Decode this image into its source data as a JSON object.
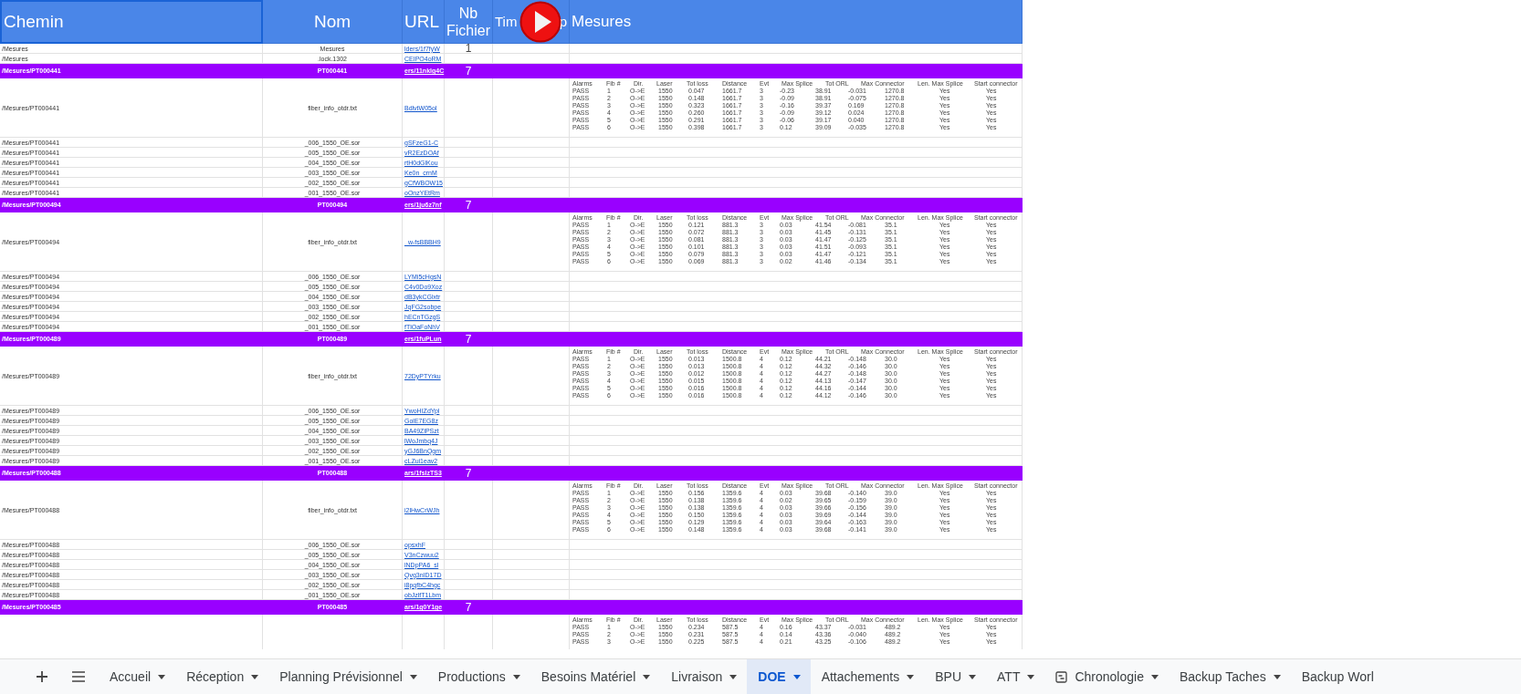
{
  "header": {
    "chemin": "Chemin",
    "nom": "Nom",
    "url": "URL",
    "nb_fichier": "Nb Fichier",
    "timestamp_visible_start": "Tim",
    "timestamp_visible_end": "p",
    "mesures": "Mesures"
  },
  "rows": [
    {
      "kind": "file",
      "chemin": "/Mesures",
      "nom": "Mesures",
      "url": "lders/1f7fyW",
      "count": "1"
    },
    {
      "kind": "file",
      "chemin": "/Mesures",
      "nom": ".lock.1302",
      "url": "CEIPO4oRM"
    },
    {
      "kind": "folder",
      "chemin": "/Mesures/PT000441",
      "nom": "PT000441",
      "url": "ers/11nklg4C",
      "count": "7"
    },
    {
      "kind": "info",
      "chemin": "/Mesures/PT000441",
      "nom": "fiber_info_otdr.txt",
      "url": "BdlvtW05oI",
      "measures": {
        "headers": [
          "Alarms",
          "Fib #",
          "Dir.",
          "Laser",
          "Tot loss",
          "Distance",
          "Evt",
          "Max Splice",
          "Tot ORL",
          "Max Connector",
          "Len. Max Splice",
          "Start connector"
        ],
        "rows": [
          [
            "PASS",
            "1",
            "O->E",
            "1550",
            "0.047",
            "1661.7",
            "3",
            "-0.23",
            "38.91",
            "-0.031",
            "1270.8",
            "Yes",
            "Yes"
          ],
          [
            "PASS",
            "2",
            "O->E",
            "1550",
            "0.148",
            "1661.7",
            "3",
            "-0.09",
            "38.91",
            "-0.075",
            "1270.8",
            "Yes",
            "Yes"
          ],
          [
            "PASS",
            "3",
            "O->E",
            "1550",
            "0.323",
            "1661.7",
            "3",
            "-0.16",
            "39.37",
            "0.169",
            "1270.8",
            "Yes",
            "Yes"
          ],
          [
            "PASS",
            "4",
            "O->E",
            "1550",
            "0.260",
            "1661.7",
            "3",
            "-0.09",
            "39.12",
            "0.024",
            "1270.8",
            "Yes",
            "Yes"
          ],
          [
            "PASS",
            "5",
            "O->E",
            "1550",
            "0.291",
            "1661.7",
            "3",
            "-0.06",
            "39.17",
            "0.040",
            "1270.8",
            "Yes",
            "Yes"
          ],
          [
            "PASS",
            "6",
            "O->E",
            "1550",
            "0.398",
            "1661.7",
            "3",
            "0.12",
            "39.09",
            "-0.035",
            "1270.8",
            "Yes",
            "Yes"
          ]
        ]
      }
    },
    {
      "kind": "file",
      "chemin": "/Mesures/PT000441",
      "nom": "_006_1550_OE.sor",
      "url": "gSFzeG1-C"
    },
    {
      "kind": "file",
      "chemin": "/Mesures/PT000441",
      "nom": "_005_1550_OE.sor",
      "url": "vR2EzDOAf"
    },
    {
      "kind": "file",
      "chemin": "/Mesures/PT000441",
      "nom": "_004_1550_OE.sor",
      "url": "rtH0dGlKou"
    },
    {
      "kind": "file",
      "chemin": "/Mesures/PT000441",
      "nom": "_003_1550_OE.sor",
      "url": "Ke0n_crnM"
    },
    {
      "kind": "file",
      "chemin": "/Mesures/PT000441",
      "nom": "_002_1550_OE.sor",
      "url": "gCfWBOW15"
    },
    {
      "kind": "file",
      "chemin": "/Mesures/PT000441",
      "nom": "_001_1550_OE.sor",
      "url": "oOnzYEtRm"
    },
    {
      "kind": "folder",
      "chemin": "/Mesures/PT000494",
      "nom": "PT000494",
      "url": "ers/1ju6z7nf",
      "count": "7"
    },
    {
      "kind": "info",
      "chemin": "/Mesures/PT000494",
      "nom": "fiber_info_otdr.txt",
      "url": "_w-fsBBBH9",
      "measures": {
        "headers": [
          "Alarms",
          "Fib #",
          "Dir.",
          "Laser",
          "Tot loss",
          "Distance",
          "Evt",
          "Max Splice",
          "Tot ORL",
          "Max Connector",
          "Len. Max Splice",
          "Start connector"
        ],
        "rows": [
          [
            "PASS",
            "1",
            "O->E",
            "1550",
            "0.121",
            "881.3",
            "3",
            "0.03",
            "41.54",
            "-0.081",
            "35.1",
            "Yes",
            "Yes"
          ],
          [
            "PASS",
            "2",
            "O->E",
            "1550",
            "0.072",
            "881.3",
            "3",
            "0.03",
            "41.45",
            "-0.131",
            "35.1",
            "Yes",
            "Yes"
          ],
          [
            "PASS",
            "3",
            "O->E",
            "1550",
            "0.081",
            "881.3",
            "3",
            "0.03",
            "41.47",
            "-0.125",
            "35.1",
            "Yes",
            "Yes"
          ],
          [
            "PASS",
            "4",
            "O->E",
            "1550",
            "0.101",
            "881.3",
            "3",
            "0.03",
            "41.51",
            "-0.093",
            "35.1",
            "Yes",
            "Yes"
          ],
          [
            "PASS",
            "5",
            "O->E",
            "1550",
            "0.079",
            "881.3",
            "3",
            "0.03",
            "41.47",
            "-0.121",
            "35.1",
            "Yes",
            "Yes"
          ],
          [
            "PASS",
            "6",
            "O->E",
            "1550",
            "0.069",
            "881.3",
            "3",
            "0.02",
            "41.46",
            "-0.134",
            "35.1",
            "Yes",
            "Yes"
          ]
        ]
      }
    },
    {
      "kind": "file",
      "chemin": "/Mesures/PT000494",
      "nom": "_006_1550_OE.sor",
      "url": "LYMi5cHgsN"
    },
    {
      "kind": "file",
      "chemin": "/Mesures/PT000494",
      "nom": "_005_1550_OE.sor",
      "url": "C4v0Do9Xoz"
    },
    {
      "kind": "file",
      "chemin": "/Mesures/PT000494",
      "nom": "_004_1550_OE.sor",
      "url": "dB3ykCGlxtr"
    },
    {
      "kind": "file",
      "chemin": "/Mesures/PT000494",
      "nom": "_003_1550_OE.sor",
      "url": "JqFG2sobpe"
    },
    {
      "kind": "file",
      "chemin": "/Mesures/PT000494",
      "nom": "_002_1550_OE.sor",
      "url": "hECnTGzgS"
    },
    {
      "kind": "file",
      "chemin": "/Mesures/PT000494",
      "nom": "_001_1550_OE.sor",
      "url": "fTlOaFoNhV"
    },
    {
      "kind": "folder",
      "chemin": "/Mesures/PT000489",
      "nom": "PT000489",
      "url": "ers/1fuPLun",
      "count": "7"
    },
    {
      "kind": "info",
      "chemin": "/Mesures/PT000489",
      "nom": "fiber_info_otdr.txt",
      "url": "72DyPTYrku",
      "measures": {
        "headers": [
          "Alarms",
          "Fib #",
          "Dir.",
          "Laser",
          "Tot loss",
          "Distance",
          "Evt",
          "Max Splice",
          "Tot ORL",
          "Max Connector",
          "Len. Max Splice",
          "Start connector"
        ],
        "rows": [
          [
            "PASS",
            "1",
            "O->E",
            "1550",
            "0.013",
            "1500.8",
            "4",
            "0.12",
            "44.21",
            "-0.148",
            "30.0",
            "Yes",
            "Yes"
          ],
          [
            "PASS",
            "2",
            "O->E",
            "1550",
            "0.013",
            "1500.8",
            "4",
            "0.12",
            "44.32",
            "-0.146",
            "30.0",
            "Yes",
            "Yes"
          ],
          [
            "PASS",
            "3",
            "O->E",
            "1550",
            "0.012",
            "1500.8",
            "4",
            "0.12",
            "44.27",
            "-0.148",
            "30.0",
            "Yes",
            "Yes"
          ],
          [
            "PASS",
            "4",
            "O->E",
            "1550",
            "0.015",
            "1500.8",
            "4",
            "0.12",
            "44.13",
            "-0.147",
            "30.0",
            "Yes",
            "Yes"
          ],
          [
            "PASS",
            "5",
            "O->E",
            "1550",
            "0.016",
            "1500.8",
            "4",
            "0.12",
            "44.16",
            "-0.144",
            "30.0",
            "Yes",
            "Yes"
          ],
          [
            "PASS",
            "6",
            "O->E",
            "1550",
            "0.016",
            "1500.8",
            "4",
            "0.12",
            "44.12",
            "-0.146",
            "30.0",
            "Yes",
            "Yes"
          ]
        ]
      }
    },
    {
      "kind": "file",
      "chemin": "/Mesures/PT000489",
      "nom": "_006_1550_OE.sor",
      "url": "YwoHIZdYpl"
    },
    {
      "kind": "file",
      "chemin": "/Mesures/PT000489",
      "nom": "_005_1550_OE.sor",
      "url": "GolE7EG8z"
    },
    {
      "kind": "file",
      "chemin": "/Mesures/PT000489",
      "nom": "_004_1550_OE.sor",
      "url": "BA49ZlPSzt"
    },
    {
      "kind": "file",
      "chemin": "/Mesures/PT000489",
      "nom": "_003_1550_OE.sor",
      "url": "lWoJmbq4J"
    },
    {
      "kind": "file",
      "chemin": "/Mesures/PT000489",
      "nom": "_002_1550_OE.sor",
      "url": "yGJ6BnQgm"
    },
    {
      "kind": "file",
      "chemin": "/Mesures/PT000489",
      "nom": "_001_1550_OE.sor",
      "url": "cLZui1eav2"
    },
    {
      "kind": "folder",
      "chemin": "/Mesures/PT000488",
      "nom": "PT000488",
      "url": "ars/1fslzTS3",
      "count": "7"
    },
    {
      "kind": "info",
      "chemin": "/Mesures/PT000488",
      "nom": "fiber_info_otdr.txt",
      "url": "i2lHwCrWJh",
      "measures": {
        "headers": [
          "Alarms",
          "Fib #",
          "Dir.",
          "Laser",
          "Tot loss",
          "Distance",
          "Evt",
          "Max Splice",
          "Tot ORL",
          "Max Connector",
          "Len. Max Splice",
          "Start connector"
        ],
        "rows": [
          [
            "PASS",
            "1",
            "O->E",
            "1550",
            "0.156",
            "1359.6",
            "4",
            "0.03",
            "39.68",
            "-0.140",
            "39.0",
            "Yes",
            "Yes"
          ],
          [
            "PASS",
            "2",
            "O->E",
            "1550",
            "0.138",
            "1359.6",
            "4",
            "0.02",
            "39.65",
            "-0.159",
            "39.0",
            "Yes",
            "Yes"
          ],
          [
            "PASS",
            "3",
            "O->E",
            "1550",
            "0.138",
            "1359.6",
            "4",
            "0.03",
            "39.66",
            "-0.156",
            "39.0",
            "Yes",
            "Yes"
          ],
          [
            "PASS",
            "4",
            "O->E",
            "1550",
            "0.150",
            "1359.6",
            "4",
            "0.03",
            "39.69",
            "-0.144",
            "39.0",
            "Yes",
            "Yes"
          ],
          [
            "PASS",
            "5",
            "O->E",
            "1550",
            "0.129",
            "1359.6",
            "4",
            "0.03",
            "39.64",
            "-0.163",
            "39.0",
            "Yes",
            "Yes"
          ],
          [
            "PASS",
            "6",
            "O->E",
            "1550",
            "0.148",
            "1359.6",
            "4",
            "0.03",
            "39.68",
            "-0.141",
            "39.0",
            "Yes",
            "Yes"
          ]
        ]
      }
    },
    {
      "kind": "file",
      "chemin": "/Mesures/PT000488",
      "nom": "_006_1550_OE.sor",
      "url": "opsxhF"
    },
    {
      "kind": "file",
      "chemin": "/Mesures/PT000488",
      "nom": "_005_1550_OE.sor",
      "url": "V3nCzwuu2"
    },
    {
      "kind": "file",
      "chemin": "/Mesures/PT000488",
      "nom": "_004_1550_OE.sor",
      "url": "lNDpPA6_sl"
    },
    {
      "kind": "file",
      "chemin": "/Mesures/PT000488",
      "nom": "_003_1550_OE.sor",
      "url": "Qvg3nID17D"
    },
    {
      "kind": "file",
      "chemin": "/Mesures/PT000488",
      "nom": "_002_1550_OE.sor",
      "url": "i8pqfbC4hgc"
    },
    {
      "kind": "file",
      "chemin": "/Mesures/PT000488",
      "nom": "_001_1550_OE.sor",
      "url": "obJzlfT1Lbm"
    },
    {
      "kind": "folder",
      "chemin": "/Mesures/PT000485",
      "nom": "PT000485",
      "url": "ars/1g0Y1ge",
      "count": "7"
    },
    {
      "kind": "info",
      "measures": {
        "headers": [
          "Alarms",
          "Fib #",
          "Dir.",
          "Laser",
          "Tot loss",
          "Distance",
          "Evt",
          "Max Splice",
          "Tot ORL",
          "Max Connector",
          "Len. Max Splice",
          "Start connector"
        ],
        "rows": [
          [
            "PASS",
            "1",
            "O->E",
            "1550",
            "0.234",
            "587.5",
            "4",
            "0.16",
            "43.37",
            "-0.031",
            "489.2",
            "Yes",
            "Yes"
          ],
          [
            "PASS",
            "2",
            "O->E",
            "1550",
            "0.231",
            "587.5",
            "4",
            "0.14",
            "43.36",
            "-0.040",
            "489.2",
            "Yes",
            "Yes"
          ],
          [
            "PASS",
            "3",
            "O->E",
            "1550",
            "0.225",
            "587.5",
            "4",
            "0.21",
            "43.25",
            "-0.106",
            "489.2",
            "Yes",
            "Yes"
          ]
        ]
      }
    }
  ],
  "sheet_tabs": [
    {
      "label": "Accueil",
      "selected": false,
      "caret": true
    },
    {
      "label": "Réception",
      "selected": false,
      "caret": true
    },
    {
      "label": "Planning Prévisionnel",
      "selected": false,
      "caret": true
    },
    {
      "label": "Productions",
      "selected": false,
      "caret": true
    },
    {
      "label": "Besoins Matériel",
      "selected": false,
      "caret": true
    },
    {
      "label": "Livraison",
      "selected": false,
      "caret": true
    },
    {
      "label": "DOE",
      "selected": true,
      "caret": true
    },
    {
      "label": "Attachements",
      "selected": false,
      "caret": true
    },
    {
      "label": "BPU",
      "selected": false,
      "caret": true
    },
    {
      "label": "ATT",
      "selected": false,
      "caret": true
    },
    {
      "label": "Chronologie",
      "selected": false,
      "caret": true,
      "kind": "with-icon"
    },
    {
      "label": "Backup Taches",
      "selected": false,
      "caret": true
    },
    {
      "label": "Backup Worl",
      "selected": false,
      "caret": false
    }
  ]
}
